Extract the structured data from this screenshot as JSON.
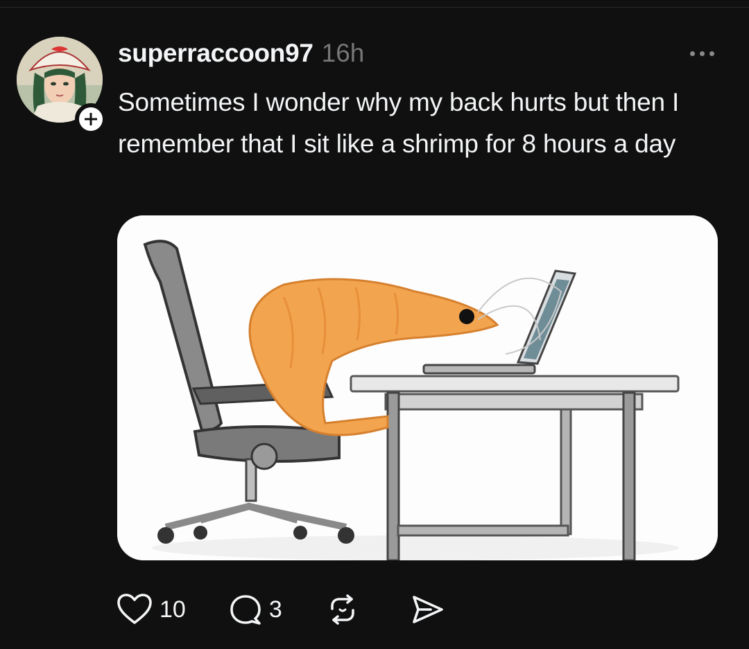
{
  "post": {
    "username": "superraccoon97",
    "timestamp": "16h",
    "text": "Sometimes I wonder why my back hurts but then I remember that I sit like a shrimp for 8 hours a day",
    "avatar_icon": "anime-character-avatar",
    "follow_icon": "plus-icon",
    "image_description_icon": "shrimp-at-desk-image"
  },
  "actions": {
    "likes": "10",
    "comments": "3",
    "like_icon": "heart-icon",
    "comment_icon": "comment-bubble-icon",
    "repost_icon": "repost-icon",
    "share_icon": "send-icon"
  },
  "colors": {
    "background": "#101010",
    "text": "#f3f5f7",
    "muted": "#777777"
  }
}
